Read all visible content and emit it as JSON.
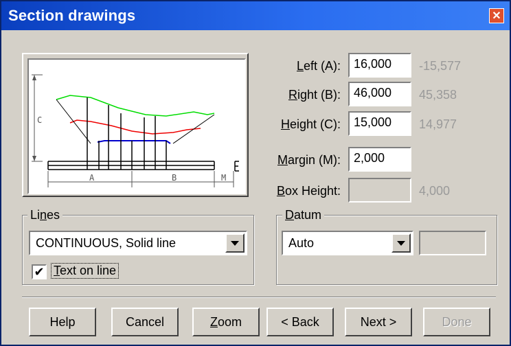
{
  "window": {
    "title": "Section drawings",
    "close_icon": "close-icon"
  },
  "preview": {
    "label_c": "C",
    "label_a": "A",
    "label_b": "B",
    "label_m": "M",
    "label_e": "E",
    "colors": {
      "green": "#00dd00",
      "red": "#ee0000",
      "blue": "#0000cc"
    }
  },
  "fields": {
    "left": {
      "label_pre": "",
      "label_ul": "L",
      "label_post": "eft (A):",
      "value": "16,000",
      "computed": "-15,577"
    },
    "right": {
      "label_pre": "",
      "label_ul": "R",
      "label_post": "ight (B):",
      "value": "46,000",
      "computed": "45,358"
    },
    "height": {
      "label_pre": "",
      "label_ul": "H",
      "label_post": "eight (C):",
      "value": "15,000",
      "computed": "14,977"
    },
    "margin": {
      "label_pre": "",
      "label_ul": "M",
      "label_post": "argin (M):",
      "value": "2,000"
    },
    "box_height": {
      "label_pre": "",
      "label_ul": "B",
      "label_post": "ox Height:",
      "value": "",
      "computed": "4,000"
    }
  },
  "lines": {
    "legend_pre": "Li",
    "legend_ul": "n",
    "legend_post": "es",
    "selected": "CONTINUOUS, Solid line",
    "checkbox_mark": "✔",
    "checkbox_label_ul": "T",
    "checkbox_label_post": "ext on line"
  },
  "datum": {
    "legend_ul": "D",
    "legend_post": "atum",
    "selected": "Auto",
    "value": ""
  },
  "buttons": {
    "help": "Help",
    "cancel": "Cancel",
    "zoom_ul": "Z",
    "zoom_post": "oom",
    "back": "< Back",
    "next": "Next >",
    "done": "Done"
  }
}
